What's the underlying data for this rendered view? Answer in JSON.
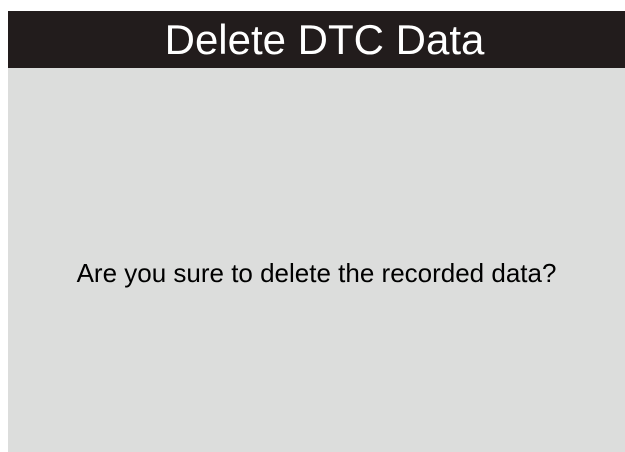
{
  "header": {
    "title": "Delete DTC Data"
  },
  "dialog": {
    "message": "Are you sure to delete the recorded data?"
  },
  "colors": {
    "header_background": "#221c1c",
    "screen_background": "#dcdddc",
    "header_text": "#ffffff",
    "body_text": "#000000"
  }
}
